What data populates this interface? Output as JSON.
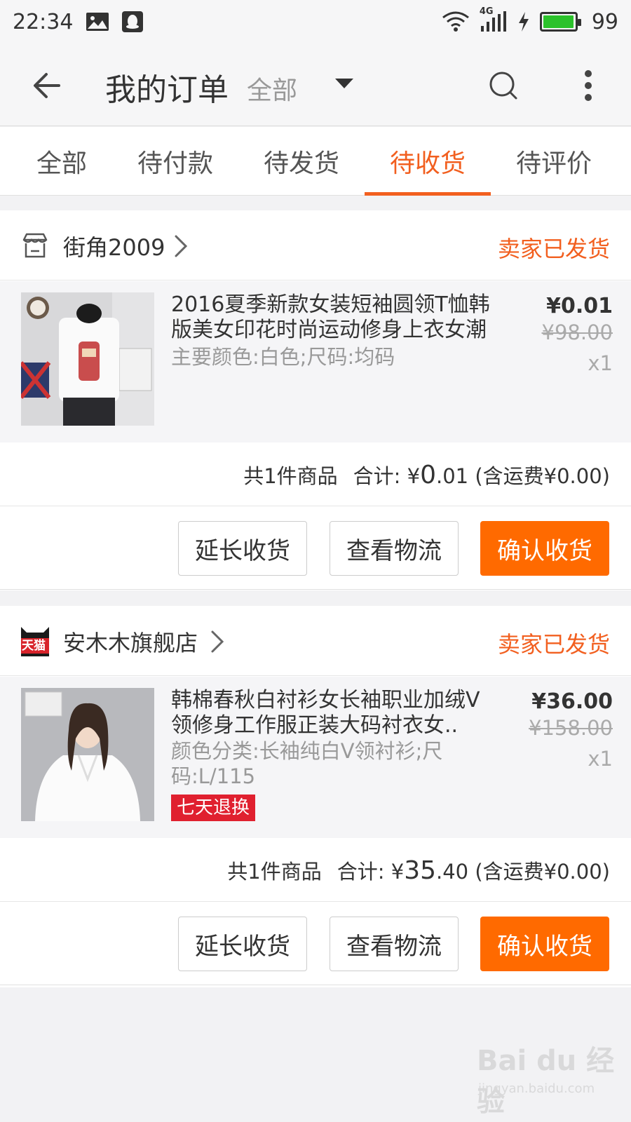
{
  "status_bar": {
    "time": "22:34",
    "network": "4G",
    "battery": "99",
    "battery_level": 0.99
  },
  "nav": {
    "title": "我的订单",
    "filter": "全部"
  },
  "tabs": [
    {
      "label": "全部",
      "active": false
    },
    {
      "label": "待付款",
      "active": false
    },
    {
      "label": "待发货",
      "active": false
    },
    {
      "label": "待收货",
      "active": true
    },
    {
      "label": "待评价",
      "active": false
    }
  ],
  "orders": [
    {
      "shop_name": "街角2009",
      "shop_icon": "store-icon",
      "status": "卖家已发货",
      "item": {
        "title": "2016夏季新款女装短袖圆领T恤韩版美女印花时尚运动修身上衣女潮",
        "attrs": "主要颜色:白色;尺码:均码",
        "price": "¥0.01",
        "original_price": "¥98.00",
        "quantity": "x1"
      },
      "summary": {
        "count_text": "共1件商品",
        "total_label": "合计:",
        "currency": "¥",
        "total_int": "0",
        "total_dec": ".01",
        "shipping": "(含运费¥0.00)"
      },
      "buttons": {
        "extend": "延长收货",
        "logistics": "查看物流",
        "confirm": "确认收货"
      }
    },
    {
      "shop_name": "安木木旗舰店",
      "shop_icon": "tmall-icon",
      "shop_icon_text": "天猫",
      "status": "卖家已发货",
      "item": {
        "title": "韩棉春秋白衬衫女长袖职业加绒V领修身工作服正装大码衬衣女..",
        "attrs": "颜色分类:长袖纯白V领衬衫;尺码:L/115",
        "badge": "七天退换",
        "price": "¥36.00",
        "original_price": "¥158.00",
        "quantity": "x1"
      },
      "summary": {
        "count_text": "共1件商品",
        "total_label": "合计:",
        "currency": "¥",
        "total_int": "35",
        "total_dec": ".40",
        "shipping": "(含运费¥0.00)"
      },
      "buttons": {
        "extend": "延长收货",
        "logistics": "查看物流",
        "confirm": "确认收货"
      }
    }
  ],
  "watermark": {
    "brand": "Bai du 经验",
    "url": "jingyan.baidu.com"
  },
  "colors": {
    "accent": "#f25f1f",
    "button_primary": "#ff6a00",
    "badge": "#e0202f"
  }
}
